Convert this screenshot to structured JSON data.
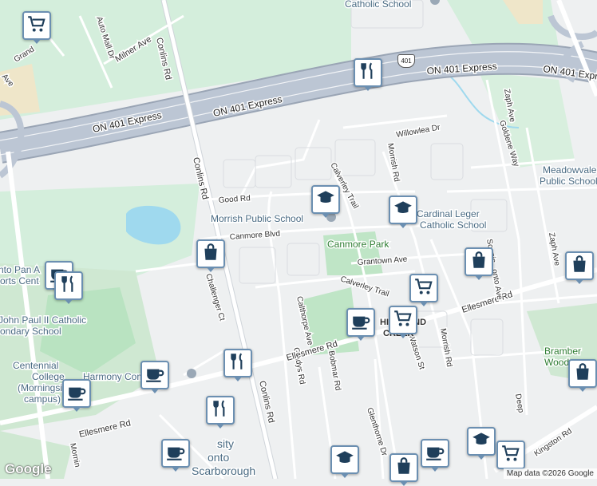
{
  "map": {
    "attribution": "Map data ©2026 Google",
    "logo": "Google",
    "highway_badge": "401",
    "highway_labels": [
      "ON 401 Express",
      "ON 401 Express",
      "ON 401 Express",
      "ON 401 Express"
    ],
    "street_labels": [
      "Conlins Rd",
      "Conlins Rd",
      "Conlins Rd",
      "Milner Ave",
      "Grand",
      "Auto Mall Dr",
      "Ave",
      "Good Rd",
      "Canmore Blvd",
      "Calverley Trail",
      "Calverley Trail",
      "Morrish Rd",
      "Morrish Rd",
      "Willowlea Dr",
      "Zaph Ave",
      "Zaph Ave",
      "Goldene Way",
      "Grantown Ave",
      "Challenger Ct",
      "Calthorpe Ave",
      "Gladys Rd",
      "Bobmar Rd",
      "Watson St",
      "Ellesmere Rd",
      "Ellesmere Rd",
      "Ellesmere Rd",
      "Glenthorne Dr",
      "Deep",
      "Scenic...onto Ave",
      "Kingston Rd",
      "Mornin"
    ],
    "poi_labels": [
      "Catholic School",
      "Morrish Public School",
      "Cardinal Leger",
      "Catholic School",
      "Meadowvale",
      "Public School",
      "Canmore Park",
      "Bramber",
      "Woods",
      "Harmony Commons",
      "Centennial",
      "College",
      "(Morningside",
      "campus)",
      "John Paul II Catholic",
      "ondary School",
      "nto Pan A",
      "orts Cent",
      "HIGHLAND",
      "CREEK",
      "sity",
      "onto",
      "Scarborough"
    ]
  },
  "markers": [
    {
      "icon": "shopping-cart-icon",
      "label": "Shopping"
    },
    {
      "icon": "restaurant-icon",
      "label": "Restaurant"
    },
    {
      "icon": "school-icon",
      "label": "School"
    },
    {
      "icon": "school-icon",
      "label": "School"
    },
    {
      "icon": "shopping-bag-icon",
      "label": "Shop"
    },
    {
      "icon": "shopping-bag-icon",
      "label": "Shop"
    },
    {
      "icon": "shopping-bag-icon",
      "label": "Shop"
    },
    {
      "icon": "shopping-cart-icon",
      "label": "Shopping"
    },
    {
      "icon": "shopping-cart-icon",
      "label": "Shopping"
    },
    {
      "icon": "coffee-icon",
      "label": "Cafe"
    },
    {
      "icon": "coffee-icon",
      "label": "Cafe"
    },
    {
      "icon": "coffee-icon",
      "label": "Cafe"
    },
    {
      "icon": "coffee-icon",
      "label": "Cafe"
    },
    {
      "icon": "restaurant-icon",
      "label": "Restaurant"
    },
    {
      "icon": "restaurant-icon",
      "label": "Restaurant"
    },
    {
      "icon": "restaurant-icon",
      "label": "Restaurant"
    },
    {
      "icon": "coffee-icon",
      "label": "Cafe"
    },
    {
      "icon": "school-icon",
      "label": "School"
    },
    {
      "icon": "shopping-bag-icon",
      "label": "Shop"
    },
    {
      "icon": "coffee-icon",
      "label": "Cafe"
    },
    {
      "icon": "school-icon",
      "label": "School"
    },
    {
      "icon": "shopping-cart-icon",
      "label": "Shopping"
    },
    {
      "icon": "shopping-bag-icon",
      "label": "Shop"
    }
  ]
}
